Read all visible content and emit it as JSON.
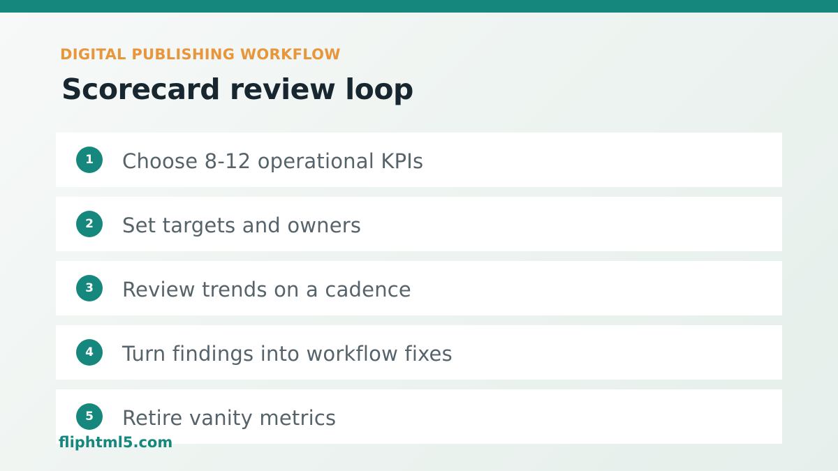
{
  "header": {
    "eyebrow": "DIGITAL PUBLISHING WORKFLOW",
    "title": "Scorecard review loop"
  },
  "steps": [
    {
      "number": "1",
      "text": "Choose 8-12 operational KPIs"
    },
    {
      "number": "2",
      "text": "Set targets and owners"
    },
    {
      "number": "3",
      "text": "Review trends on a cadence"
    },
    {
      "number": "4",
      "text": "Turn findings into workflow fixes"
    },
    {
      "number": "5",
      "text": "Retire vanity metrics"
    }
  ],
  "watermark": "fliphtml5.com",
  "colors": {
    "accent": "#16877c",
    "eyebrow": "#e8963c",
    "title": "#17262f",
    "body_text": "#56636a"
  }
}
